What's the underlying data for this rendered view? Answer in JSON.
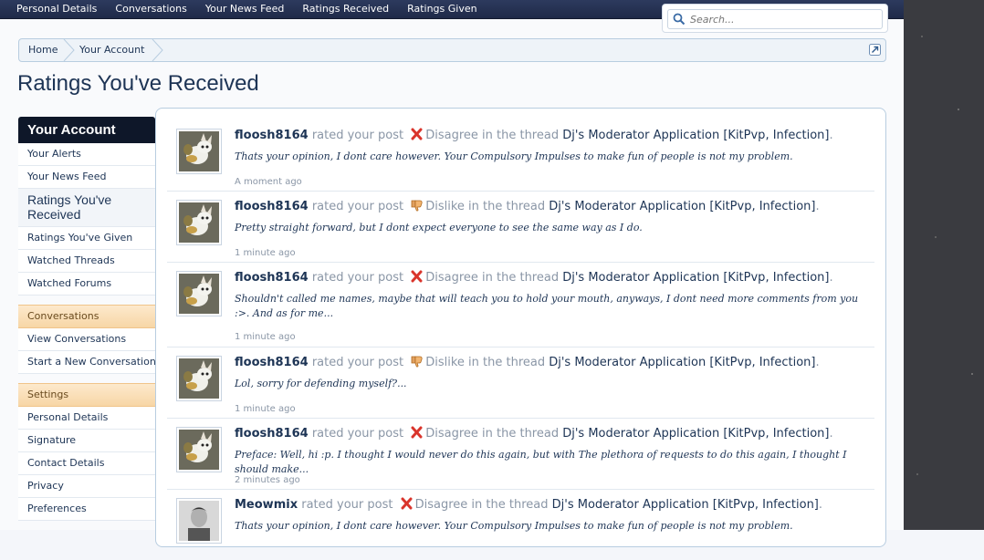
{
  "topnav": {
    "tabs": [
      "Personal Details",
      "Conversations",
      "Your News Feed",
      "Ratings Received",
      "Ratings Given"
    ]
  },
  "search": {
    "placeholder": "Search..."
  },
  "breadcrumb": {
    "items": [
      "Home",
      "Your Account"
    ]
  },
  "page_title": "Ratings You've Received",
  "sidebar": {
    "header": "Your Account",
    "account_items": [
      "Your Alerts",
      "Your News Feed",
      "Ratings You've Received",
      "Ratings You've Given",
      "Watched Threads",
      "Watched Forums"
    ],
    "conversations_header": "Conversations",
    "conversations_items": [
      "View Conversations",
      "Start a New Conversation"
    ],
    "settings_header": "Settings",
    "settings_items": [
      "Personal Details",
      "Signature",
      "Contact Details",
      "Privacy",
      "Preferences"
    ]
  },
  "entries": [
    {
      "user": "floosh8164",
      "verb": "rated your post",
      "rating": "Disagree",
      "rating_icon": "red-x-icon",
      "prep": "in the thread",
      "thread": "Dj's Moderator Application [KitPvp, Infection]",
      "excerpt": "Thats your opinion, I dont care however. Your Compulsory Impulses to make fun of people is not my problem.",
      "time": "A moment ago"
    },
    {
      "user": "floosh8164",
      "verb": "rated your post",
      "rating": "Dislike",
      "rating_icon": "thumbs-down-icon",
      "prep": "in the thread",
      "thread": "Dj's Moderator Application [KitPvp, Infection]",
      "excerpt": "Pretty straight forward, but I dont expect everyone to see the same way as I do.",
      "time": "1 minute ago"
    },
    {
      "user": "floosh8164",
      "verb": "rated your post",
      "rating": "Disagree",
      "rating_icon": "red-x-icon",
      "prep": "in the thread",
      "thread": "Dj's Moderator Application [KitPvp, Infection]",
      "excerpt": "Shouldn't called me names, maybe that will teach you to hold your mouth, anyways, I dont need more comments from you :>. And as for me...",
      "time": "1 minute ago"
    },
    {
      "user": "floosh8164",
      "verb": "rated your post",
      "rating": "Dislike",
      "rating_icon": "thumbs-down-icon",
      "prep": "in the thread",
      "thread": "Dj's Moderator Application [KitPvp, Infection]",
      "excerpt": "Lol, sorry for defending myself?...",
      "time": "1 minute ago"
    },
    {
      "user": "floosh8164",
      "verb": "rated your post",
      "rating": "Disagree",
      "rating_icon": "red-x-icon",
      "prep": "in the thread",
      "thread": "Dj's Moderator Application [KitPvp, Infection]",
      "excerpt": "Preface: Well, hi :p. I thought I would never do this again, but with The plethora of requests to do this again, I thought I should make...",
      "time": "2 minutes ago"
    },
    {
      "user": "Meowmix",
      "verb": "rated your post",
      "rating": "Disagree",
      "rating_icon": "red-x-icon",
      "prep": "in the thread",
      "thread": "Dj's Moderator Application [KitPvp, Infection]",
      "excerpt": "Thats your opinion, I dont care however. Your Compulsory Impulses to make fun of people is not my problem.",
      "time": ""
    }
  ]
}
